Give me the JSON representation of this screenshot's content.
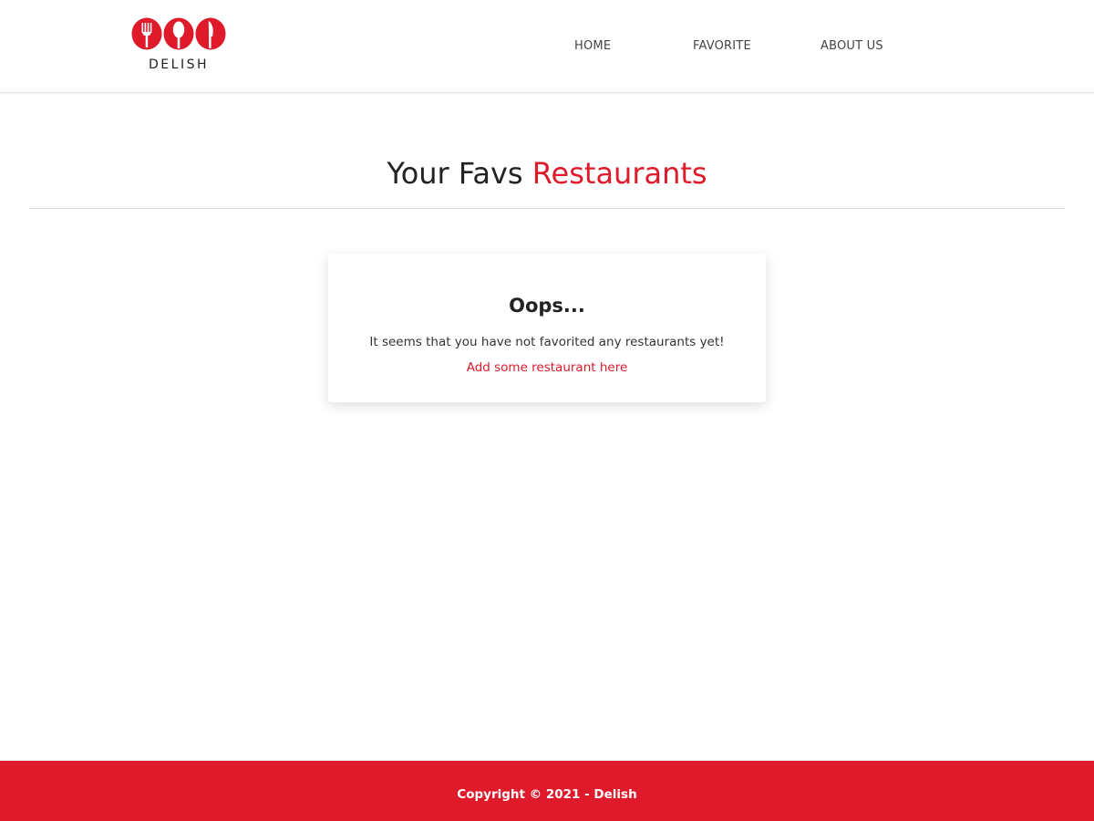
{
  "header": {
    "logo": {
      "icon": "fork-spoon-knife-icon",
      "text": "DELISH"
    },
    "nav": {
      "home": "HOME",
      "favorite": "FAVORITE",
      "about": "ABOUT US"
    }
  },
  "main": {
    "title_prefix": "Your Favs",
    "title_accent": "Restaurants",
    "empty_state": {
      "title": "Oops...",
      "message": "It seems that you have not favorited any restaurants yet!",
      "link": "Add some restaurant here"
    }
  },
  "footer": {
    "copyright": "Copyright © 2021 - Delish"
  },
  "colors": {
    "accent": "#de1a2b",
    "text": "#222222",
    "background": "#ffffff"
  }
}
